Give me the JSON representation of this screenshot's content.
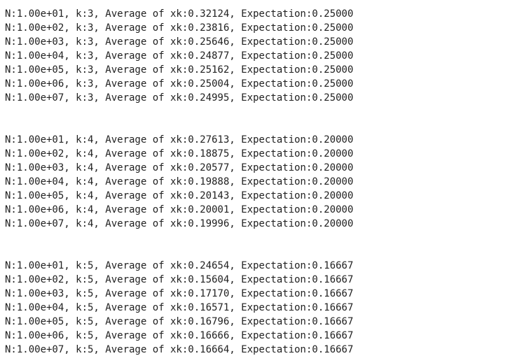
{
  "output": {
    "blocks": [
      {
        "lines": [
          "N:1.00e+01, k:3, Average of xk:0.32124, Expectation:0.25000",
          "N:1.00e+02, k:3, Average of xk:0.23816, Expectation:0.25000",
          "N:1.00e+03, k:3, Average of xk:0.25646, Expectation:0.25000",
          "N:1.00e+04, k:3, Average of xk:0.24877, Expectation:0.25000",
          "N:1.00e+05, k:3, Average of xk:0.25162, Expectation:0.25000",
          "N:1.00e+06, k:3, Average of xk:0.25004, Expectation:0.25000",
          "N:1.00e+07, k:3, Average of xk:0.24995, Expectation:0.25000"
        ]
      },
      {
        "lines": [
          "N:1.00e+01, k:4, Average of xk:0.27613, Expectation:0.20000",
          "N:1.00e+02, k:4, Average of xk:0.18875, Expectation:0.20000",
          "N:1.00e+03, k:4, Average of xk:0.20577, Expectation:0.20000",
          "N:1.00e+04, k:4, Average of xk:0.19888, Expectation:0.20000",
          "N:1.00e+05, k:4, Average of xk:0.20143, Expectation:0.20000",
          "N:1.00e+06, k:4, Average of xk:0.20001, Expectation:0.20000",
          "N:1.00e+07, k:4, Average of xk:0.19996, Expectation:0.20000"
        ]
      },
      {
        "lines": [
          "N:1.00e+01, k:5, Average of xk:0.24654, Expectation:0.16667",
          "N:1.00e+02, k:5, Average of xk:0.15604, Expectation:0.16667",
          "N:1.00e+03, k:5, Average of xk:0.17170, Expectation:0.16667",
          "N:1.00e+04, k:5, Average of xk:0.16571, Expectation:0.16667",
          "N:1.00e+05, k:5, Average of xk:0.16796, Expectation:0.16667",
          "N:1.00e+06, k:5, Average of xk:0.16666, Expectation:0.16667",
          "N:1.00e+07, k:5, Average of xk:0.16664, Expectation:0.16667"
        ]
      }
    ]
  }
}
